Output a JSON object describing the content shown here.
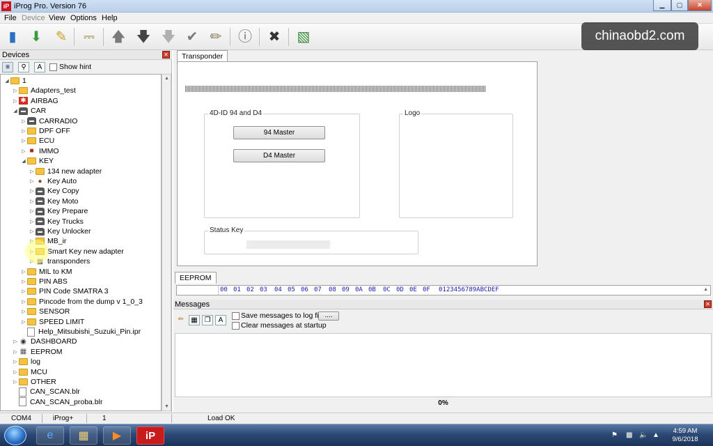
{
  "window": {
    "title": "iProg Pro. Version 76",
    "icon_text": "iP",
    "min": "▁",
    "max": "▢",
    "close": "✕"
  },
  "menu": [
    "File",
    "Device",
    "View",
    "Options",
    "Help"
  ],
  "toolbar": [
    "read-icon",
    "load-file-icon",
    "new-file-icon",
    "erase-icon",
    "arrow-up-icon",
    "arrow-down-icon",
    "arrow-down-disabled-icon",
    "check-icon",
    "clear-brush-icon",
    "info-icon",
    "stop-icon",
    "calculator-icon"
  ],
  "watermark": "chinaobd2.com",
  "devices": {
    "title": "Devices",
    "show_hint": "Show hint",
    "tree": [
      {
        "label": "1",
        "level": 0,
        "icon": "folder",
        "arrow": "◢"
      },
      {
        "label": "Adapters_test",
        "level": 1,
        "icon": "folder",
        "arrow": "▷"
      },
      {
        "label": "AIRBAG",
        "level": 1,
        "icon": "airbag",
        "arrow": "▷"
      },
      {
        "label": "CAR",
        "level": 1,
        "icon": "car",
        "arrow": "◢"
      },
      {
        "label": "CARRADIO",
        "level": 2,
        "icon": "car",
        "arrow": "▷"
      },
      {
        "label": "DPF OFF",
        "level": 2,
        "icon": "folder",
        "arrow": "▷"
      },
      {
        "label": "ECU",
        "level": 2,
        "icon": "folder",
        "arrow": "▷"
      },
      {
        "label": "IMMO",
        "level": 2,
        "icon": "lock",
        "arrow": "▷"
      },
      {
        "label": "KEY",
        "level": 2,
        "icon": "folder",
        "arrow": "◢"
      },
      {
        "label": "134 new adapter",
        "level": 3,
        "icon": "folder",
        "arrow": "▷"
      },
      {
        "label": "Key Auto",
        "level": 3,
        "icon": "key",
        "arrow": "▷"
      },
      {
        "label": "Key Copy",
        "level": 3,
        "icon": "car",
        "arrow": "▷"
      },
      {
        "label": "Key Moto",
        "level": 3,
        "icon": "car",
        "arrow": "▷"
      },
      {
        "label": "Key Prepare",
        "level": 3,
        "icon": "car",
        "arrow": "▷"
      },
      {
        "label": "Key Trucks",
        "level": 3,
        "icon": "car",
        "arrow": "▷"
      },
      {
        "label": "Key Unlocker",
        "level": 3,
        "icon": "car",
        "arrow": "▷"
      },
      {
        "label": "MB_ir",
        "level": 3,
        "icon": "folder",
        "arrow": "▷"
      },
      {
        "label": "Smart Key new adapter",
        "level": 3,
        "icon": "folder",
        "arrow": "▷"
      },
      {
        "label": "transponders",
        "level": 3,
        "icon": "chip",
        "arrow": "▷"
      },
      {
        "label": "MIL to KM",
        "level": 2,
        "icon": "folder",
        "arrow": "▷"
      },
      {
        "label": "PIN ABS",
        "level": 2,
        "icon": "folder",
        "arrow": "▷"
      },
      {
        "label": "PIN Code SMATRA 3",
        "level": 2,
        "icon": "folder",
        "arrow": "▷"
      },
      {
        "label": "Pincode from the dump v 1_0_3",
        "level": 2,
        "icon": "folder",
        "arrow": "▷"
      },
      {
        "label": "SENSOR",
        "level": 2,
        "icon": "folder",
        "arrow": "▷"
      },
      {
        "label": "SPEED LIMIT",
        "level": 2,
        "icon": "folder",
        "arrow": "▷"
      },
      {
        "label": "Help_Mitsubishi_Suzuki_Pin.ipr",
        "level": 2,
        "icon": "file",
        "arrow": ""
      },
      {
        "label": "DASHBOARD",
        "level": 1,
        "icon": "gauge",
        "arrow": "▷"
      },
      {
        "label": "EEPROM",
        "level": 1,
        "icon": "chip",
        "arrow": "▷"
      },
      {
        "label": "log",
        "level": 1,
        "icon": "folder",
        "arrow": "▷"
      },
      {
        "label": "MCU",
        "level": 1,
        "icon": "folder",
        "arrow": "▷"
      },
      {
        "label": "OTHER",
        "level": 1,
        "icon": "folder",
        "arrow": "▷"
      },
      {
        "label": "CAN_SCAN.blr",
        "level": 1,
        "icon": "file",
        "arrow": ""
      },
      {
        "label": "CAN_SCAN_proba.blr",
        "level": 1,
        "icon": "file",
        "arrow": ""
      }
    ]
  },
  "transponder": {
    "tab": "Transponder",
    "group1": "4D-ID 94 and D4",
    "btn_94": "94 Master",
    "btn_d4": "D4 Master",
    "group_logo": "Logo",
    "group_status": "Status Key"
  },
  "eeprom": {
    "tab": "EEPROM",
    "hex_header": [
      "00",
      "01",
      "02",
      "03",
      "04",
      "05",
      "06",
      "07",
      "08",
      "09",
      "0A",
      "0B",
      "0C",
      "0D",
      "0E",
      "0F"
    ],
    "ascii_header": "0123456789ABCDEF"
  },
  "messages": {
    "title": "Messages",
    "save_log": "Save messages to log file",
    "browse": "....",
    "clear_startup": "Clear messages at startup",
    "progress": "0%"
  },
  "status": {
    "port": "COM4",
    "device": "iProg+",
    "num": "1",
    "msg": "Load OK"
  },
  "taskbar": {
    "time": "4:59 AM",
    "date": "9/6/2018"
  }
}
